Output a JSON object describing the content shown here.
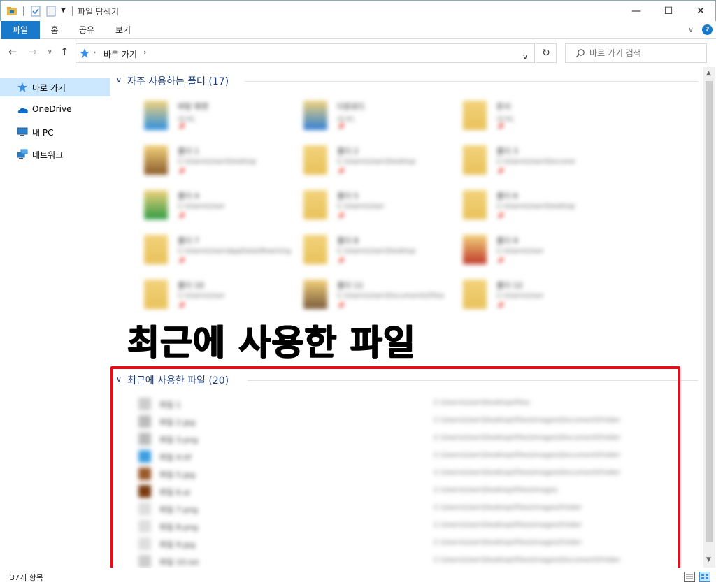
{
  "window": {
    "title": "파일 탐색기",
    "minimize_glyph": "—",
    "maximize_glyph": "☐",
    "close_glyph": "✕"
  },
  "ribbon": {
    "tabs": [
      {
        "label": "파일",
        "active": true
      },
      {
        "label": "홈"
      },
      {
        "label": "공유"
      },
      {
        "label": "보기"
      }
    ],
    "expand_glyph": "∨",
    "help_glyph": "?"
  },
  "navigation": {
    "back_glyph": "←",
    "forward_glyph": "→",
    "recent_glyph": "∨",
    "up_glyph": "↑",
    "breadcrumb": "바로 가기",
    "separator_glyph": "›",
    "dropdown_glyph": "∨",
    "refresh_glyph": "↻",
    "search_placeholder": "바로 가기 검색"
  },
  "nav_pane": {
    "items": [
      {
        "label": "바로 가기",
        "icon": "star-icon",
        "selected": true
      },
      {
        "label": "OneDrive",
        "icon": "cloud-icon"
      },
      {
        "label": "내 PC",
        "icon": "computer-icon"
      },
      {
        "label": "네트워크",
        "icon": "network-icon"
      }
    ]
  },
  "frequent_folders": {
    "title": "자주 사용하는 폴더 (17)",
    "chevron": "∨",
    "items": [
      {
        "name": "바탕 화면",
        "sub": "내 PC",
        "pin": "📌",
        "icon_color": "#2d8fe0"
      },
      {
        "name": "다운로드",
        "sub": "내 PC",
        "pin": "📌",
        "icon_color": "#2e7fd6"
      },
      {
        "name": "문서",
        "sub": "내 PC",
        "pin": "📌",
        "icon_color": "#e8c25a"
      },
      {
        "name": "폴더 1",
        "sub": "C:\\Users\\User\\Desktop",
        "pin": "📌",
        "icon_color": "#8a5a2a"
      },
      {
        "name": "폴더 2",
        "sub": "C:\\Users\\User\\Desktop",
        "pin": "📌",
        "icon_color": "#e8c25a"
      },
      {
        "name": "폴더 3",
        "sub": "C:\\Users\\User\\Docume",
        "pin": "📌",
        "icon_color": "#e8c25a"
      },
      {
        "name": "폴더 4",
        "sub": "C:\\Users\\User",
        "pin": "📌",
        "icon_color": "#2e9b45"
      },
      {
        "name": "폴더 5",
        "sub": "C:\\Users\\User",
        "pin": "📌",
        "icon_color": "#e8c25a"
      },
      {
        "name": "폴더 6",
        "sub": "C:\\Users\\User\\Desktop",
        "pin": "📌",
        "icon_color": "#e8c25a"
      },
      {
        "name": "폴더 7",
        "sub": "C:\\Users\\User\\AppData\\Roaming",
        "pin": "📌",
        "icon_color": "#e8c25a"
      },
      {
        "name": "폴더 8",
        "sub": "C:\\Users\\User\\Desktop",
        "pin": "📌",
        "icon_color": "#e8c25a"
      },
      {
        "name": "폴더 9",
        "sub": "C:\\Users\\User",
        "pin": "📌",
        "icon_color": "#c0392b"
      },
      {
        "name": "폴더 10",
        "sub": "C:\\Users\\User",
        "pin": "📌",
        "icon_color": "#e8c25a"
      },
      {
        "name": "폴더 11",
        "sub": "C:\\Users\\User\\Documents\\Files",
        "pin": "📌",
        "icon_color": "#7a5a3a"
      },
      {
        "name": "폴더 12",
        "sub": "C:\\Users\\User",
        "pin": "📌",
        "icon_color": "#e8c25a"
      }
    ]
  },
  "overlay_caption": "최근에 사용한 파일",
  "recent_files": {
    "title": "최근에 사용한 파일 (20)",
    "chevron": "∨",
    "items": [
      {
        "name": "파일 1",
        "path": "C:\\Users\\User\\Desktop\\Files",
        "icon_color": "#cccccc"
      },
      {
        "name": "파일 2.jpg",
        "path": "C:\\Users\\User\\Desktop\\Files\\Images\\Document\\Folder",
        "icon_color": "#bbbbbb"
      },
      {
        "name": "파일 3.png",
        "path": "C:\\Users\\User\\Desktop\\Files\\Images\\Document\\Folder",
        "icon_color": "#bbbbbb"
      },
      {
        "name": "파일 4.tif",
        "path": "C:\\Users\\User\\Desktop\\Files\\Images\\Document\\Folder",
        "icon_color": "#3d9ee0"
      },
      {
        "name": "파일 5.jpg",
        "path": "C:\\Users\\User\\Desktop\\Files\\Images\\Document\\Folder",
        "icon_color": "#9a5a2a"
      },
      {
        "name": "파일 6.ai",
        "path": "C:\\Users\\User\\Desktop\\Files\\Images",
        "icon_color": "#7a3a10"
      },
      {
        "name": "파일 7.png",
        "path": "C:\\Users\\User\\Desktop\\Files\\Images\\Folder",
        "icon_color": "#dddddd"
      },
      {
        "name": "파일 8.png",
        "path": "C:\\Users\\User\\Desktop\\Files\\Images\\Folder",
        "icon_color": "#dddddd"
      },
      {
        "name": "파일 9.jpg",
        "path": "C:\\Users\\User\\Desktop\\Files\\Images\\Folder",
        "icon_color": "#dddddd"
      },
      {
        "name": "파일 10.txt",
        "path": "C:\\Users\\User\\Desktop\\Files\\Images\\Document\\Folder",
        "icon_color": "#cccccc"
      }
    ]
  },
  "status": {
    "count": "37개 항목"
  },
  "colors": {
    "accent": "#1979ca",
    "group_title": "#1e3d7b",
    "selection": "#cce8ff",
    "highlight_box": "#e3101c"
  }
}
